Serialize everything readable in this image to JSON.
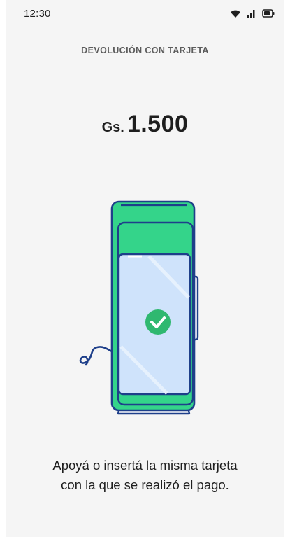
{
  "status_bar": {
    "time": "12:30",
    "icons": [
      "wifi-icon",
      "signal-icon",
      "battery-icon"
    ]
  },
  "header": {
    "title": "DEVOLUCIÓN CON TARJETA"
  },
  "amount": {
    "currency": "Gs.",
    "value": "1.500"
  },
  "illustration": {
    "name": "card-terminal-success",
    "icons": [
      "check-icon"
    ]
  },
  "instructions": {
    "line1": "Apoyá o insertá la misma tarjeta",
    "line2": "con la que se realizó el pago."
  },
  "colors": {
    "accent_green": "#34d48a",
    "outline_blue": "#1e3f8a",
    "screen_blue": "#cfe3fb",
    "check_green": "#2fb870",
    "background": "#f5f5f5"
  }
}
